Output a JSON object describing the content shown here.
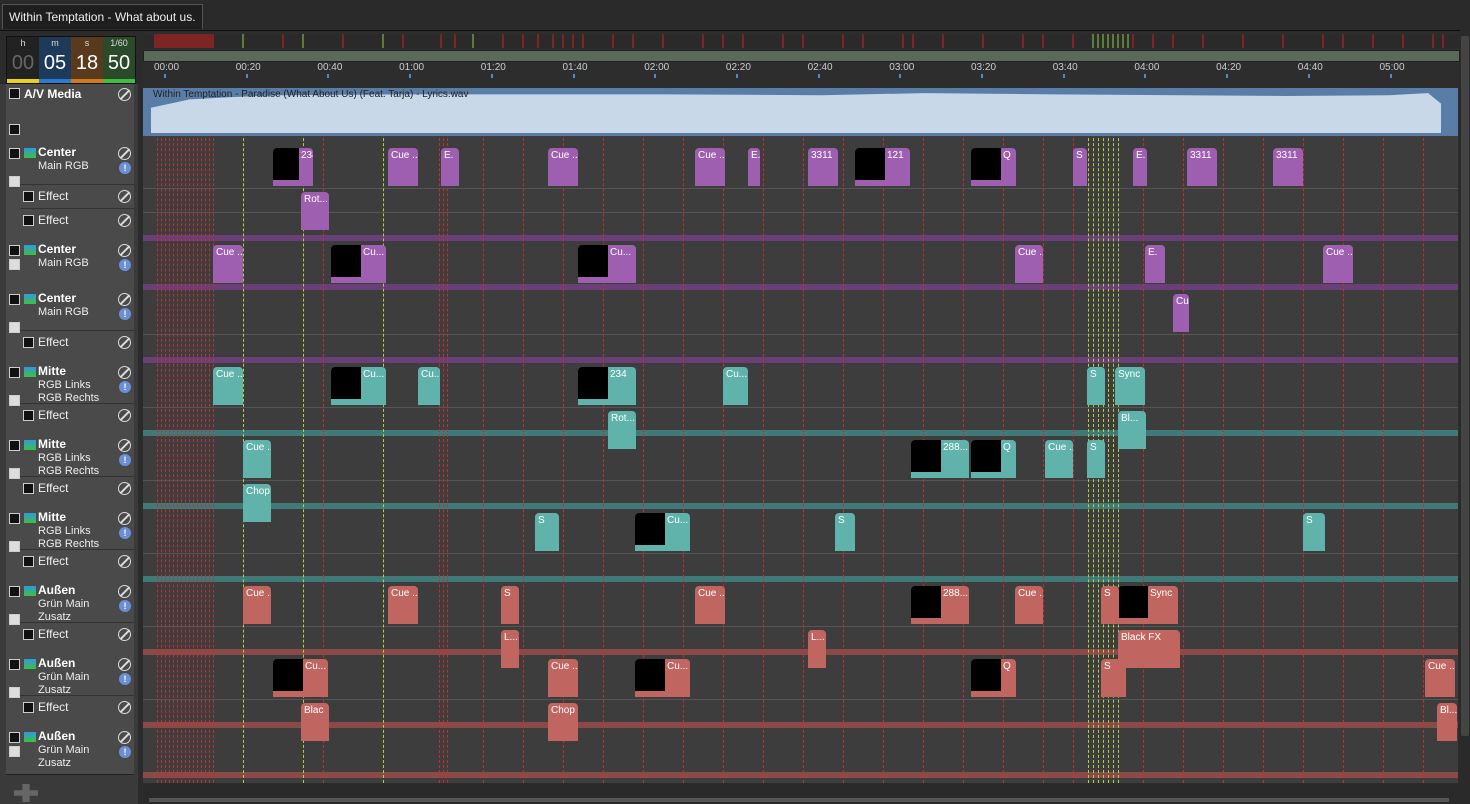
{
  "window": {
    "tab_title": "Within Temptation - What about us."
  },
  "time_display": {
    "labels": [
      "h",
      "m",
      "s",
      "1/60"
    ],
    "values": [
      "00",
      "05",
      "18",
      "50"
    ],
    "colors": [
      "#e8d020",
      "#2f7ad0",
      "#d07a20",
      "#3fbf3f"
    ]
  },
  "ruler": {
    "ticks": [
      "00:00",
      "00:20",
      "00:40",
      "01:00",
      "01:20",
      "01:40",
      "02:00",
      "02:20",
      "02:40",
      "03:00",
      "03:20",
      "03:40",
      "04:00",
      "04:20",
      "04:40",
      "05:00"
    ]
  },
  "media": {
    "title": "A/V Media",
    "file": "Within Temptation - Paradise (What About Us) (Feat. Tarja) - Lyrics.wav"
  },
  "tracks": [
    {
      "title": "Center",
      "subs": [
        "Main RGB"
      ],
      "effects": [
        "Effect",
        "Effect"
      ]
    },
    {
      "title": "Center",
      "subs": [
        "Main RGB"
      ],
      "effects": []
    },
    {
      "title": "Center",
      "subs": [
        "Main RGB"
      ],
      "effects": [
        "Effect"
      ]
    },
    {
      "title": "Mitte",
      "subs": [
        "RGB Links",
        "RGB Rechts"
      ],
      "effects": [
        "Effect"
      ]
    },
    {
      "title": "Mitte",
      "subs": [
        "RGB Links",
        "RGB Rechts"
      ],
      "effects": [
        "Effect"
      ]
    },
    {
      "title": "Mitte",
      "subs": [
        "RGB Links",
        "RGB Rechts"
      ],
      "effects": [
        "Effect"
      ]
    },
    {
      "title": "Außen",
      "subs": [
        "Grün Main",
        "Zusatz"
      ],
      "effects": [
        "Effect"
      ]
    },
    {
      "title": "Außen",
      "subs": [
        "Grün Main",
        "Zusatz"
      ],
      "effects": [
        "Effect"
      ]
    },
    {
      "title": "Außen",
      "subs": [
        "Grün Main",
        "Zusatz"
      ],
      "effects": []
    }
  ],
  "cue_labels": {
    "c1": "234",
    "cue": "Cue ...",
    "e": "E.",
    "n3311": "3311",
    "n121": "121",
    "q": "Q",
    "rot": "Rot...",
    "cu": "Cu...",
    "cuq": "Cu",
    "chop": "Chop",
    "s": "S",
    "syn": "Sync",
    "bl": "Bl...",
    "n288": "288...",
    "l": "L...",
    "black_fx": "Black FX",
    "blac": "Blac",
    "bl2": "Bl..."
  },
  "colors": {
    "purple": "#9f5fb0",
    "teal": "#5fb3ab",
    "salmon": "#c0655f",
    "purple_band": "#6a3f78",
    "teal_band": "#3f7a78",
    "salmon_band": "#8a4a48",
    "waveform": "#c8d8e8",
    "media_band": "#5a7da8"
  }
}
